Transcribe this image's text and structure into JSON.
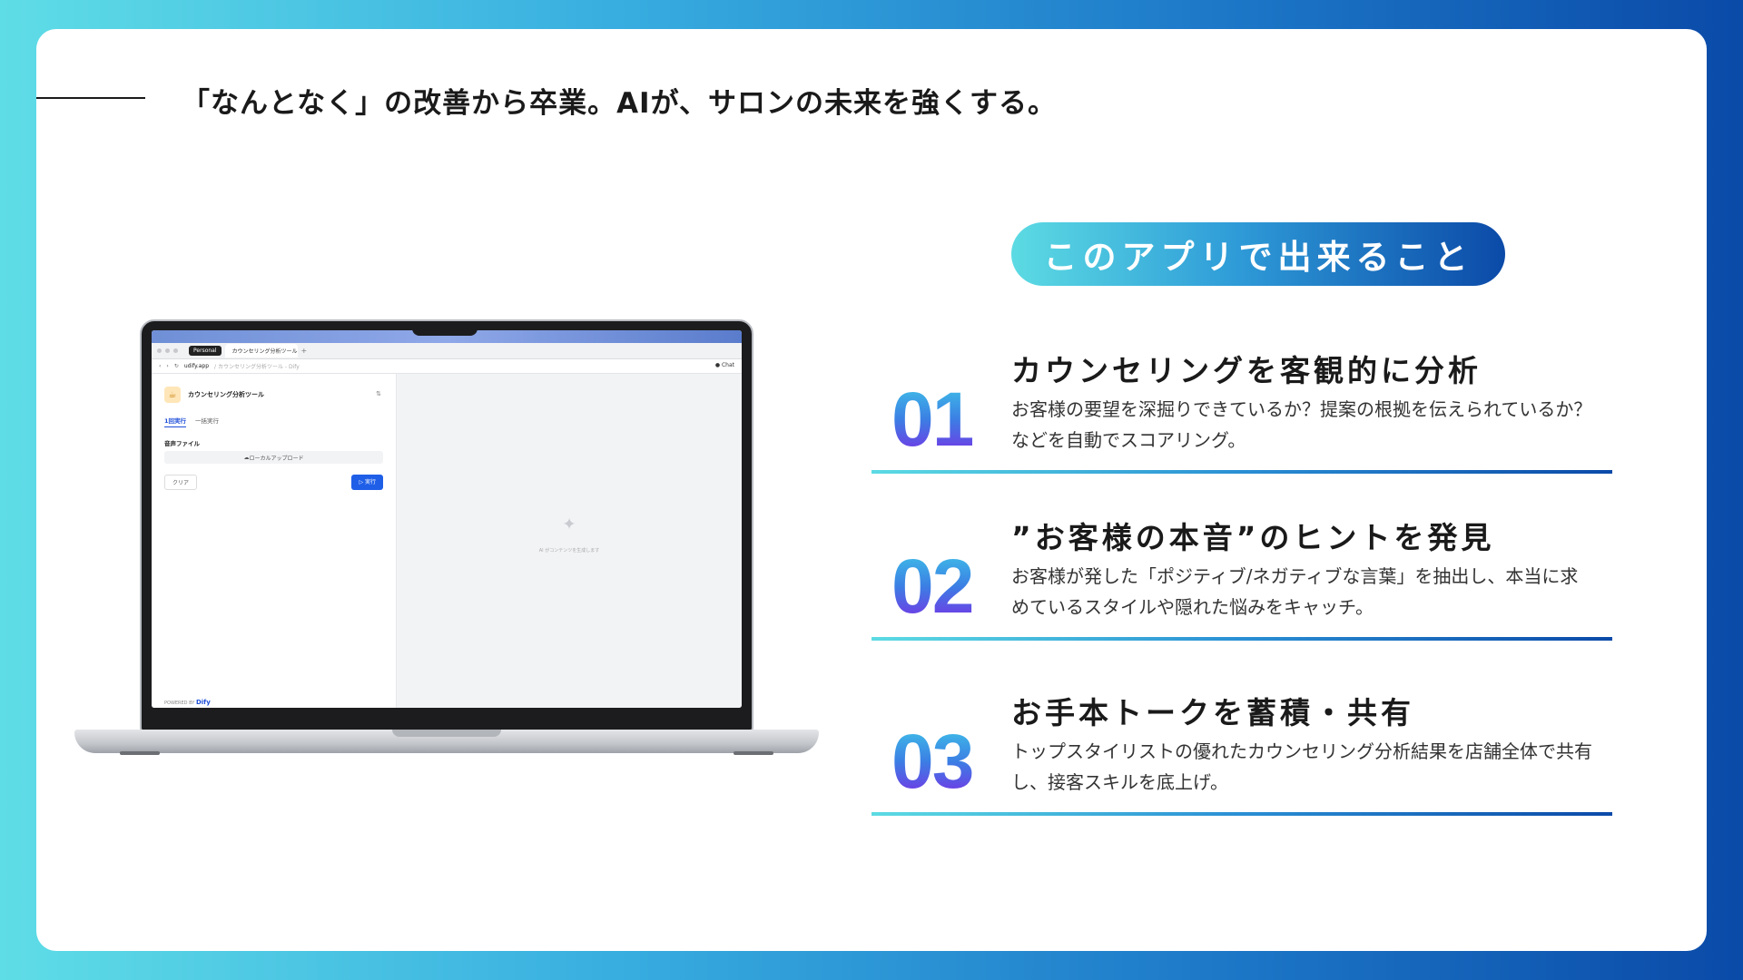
{
  "headline": "「なんとなく」の改善から卒業。AIが、サロンの未来を強くする。",
  "badge": "このアプリで出来ること",
  "features": [
    {
      "num": "01",
      "title": "カウンセリングを客観的に分析",
      "desc": "お客様の要望を深掘りできているか？提案の根拠を伝えられているか？などを自動でスコアリング。"
    },
    {
      "num": "02",
      "title": "”お客様の本音”のヒントを発見",
      "desc": "お客様が発した「ポジティブ/ネガティブな言葉」を抽出し、本当に求めているスタイルや隠れた悩みをキャッチ。"
    },
    {
      "num": "03",
      "title": "お手本トークを蓄積・共有",
      "desc": "トップスタイリストの優れたカウンセリング分析結果を店舗全体で共有し、接客スキルを底上げ。"
    }
  ],
  "screen": {
    "profile": "Personal",
    "tab_title": "カウンセリング分析ツール",
    "url": "udify.app",
    "url_path": "/ カウンセリング分析ツール - Dify",
    "chat_label": "Chat",
    "app_name": "カウンセリング分析ツール",
    "mode_single": "1回実行",
    "mode_batch": "一括実行",
    "field_label": "音声ファイル",
    "upload_label": "ローカルアップロード",
    "clear_label": "クリア",
    "run_label": "▷ 実行",
    "powered_by": "POWERED BY",
    "powered_brand": "Dify",
    "ai_note": "AI がコンテンツを生成します"
  },
  "colors": {
    "accent": "#1f5fe8",
    "gradient_start": "#5fdde6",
    "gradient_end": "#0a4aa8"
  }
}
